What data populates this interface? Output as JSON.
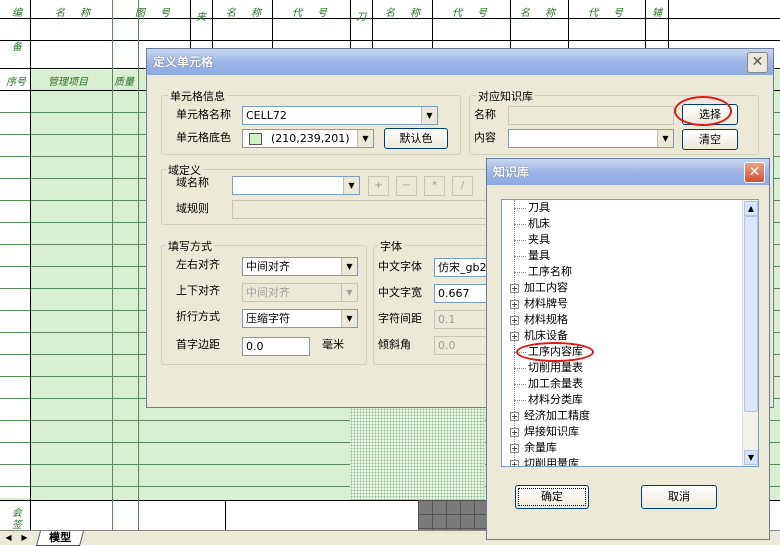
{
  "sheet": {
    "header_texts": [
      "编",
      "名 称",
      "图 号",
      "夹",
      "名 称",
      "代 号",
      "刀",
      "名 称",
      "代 号",
      "名 称",
      "代 号",
      "辅",
      "备",
      "序号",
      "管理项目",
      "质量",
      "会",
      "签"
    ],
    "tab_nav": [
      "◀",
      "▶"
    ],
    "tab_label": "模型"
  },
  "cell_dialog": {
    "title": "定义单元格",
    "close": "✕",
    "cell_info": {
      "group": "单元格信息",
      "name_label": "单元格名称",
      "name_value": "CELL72",
      "color_label": "单元格底色",
      "color_value": "(210,239,201)",
      "color_hex": "#d2efc9",
      "default_color_button": "默认色"
    },
    "knowledge": {
      "group": "对应知识库",
      "name_label": "名称",
      "content_label": "内容",
      "select_button": "选择",
      "clear_button": "清空"
    },
    "domain": {
      "group": "域定义",
      "name_label": "域名称",
      "rule_label": "域规则",
      "ops": [
        "+",
        "−",
        "*",
        "/"
      ]
    },
    "fill": {
      "group": "填写方式",
      "h_align_label": "左右对齐",
      "h_align_value": "中间对齐",
      "v_align_label": "上下对齐",
      "v_align_value": "中间对齐",
      "wrap_label": "折行方式",
      "wrap_value": "压缩字符",
      "indent_label": "首字边距",
      "indent_value": "0.0",
      "indent_unit": "毫米"
    },
    "font": {
      "group": "字体",
      "cn_font_label": "中文字体",
      "cn_font_value": "仿宋_gb2",
      "cn_width_label": "中文字宽",
      "cn_width_value": "0.667",
      "spacing_label": "字符间距",
      "spacing_value": "0.1",
      "slant_label": "倾斜角",
      "slant_value": "0.0"
    }
  },
  "kb_dialog": {
    "title": "知识库",
    "close": "✕",
    "items": [
      {
        "label": "刀具",
        "expandable": false
      },
      {
        "label": "机床",
        "expandable": false
      },
      {
        "label": "夹具",
        "expandable": false
      },
      {
        "label": "量具",
        "expandable": false
      },
      {
        "label": "工序名称",
        "expandable": false
      },
      {
        "label": "加工内容",
        "expandable": true
      },
      {
        "label": "材料牌号",
        "expandable": true
      },
      {
        "label": "材料规格",
        "expandable": true
      },
      {
        "label": "机床设备",
        "expandable": true
      },
      {
        "label": "工序内容库",
        "expandable": false
      },
      {
        "label": "切削用量表",
        "expandable": false
      },
      {
        "label": "加工余量表",
        "expandable": false
      },
      {
        "label": "材料分类库",
        "expandable": false
      },
      {
        "label": "经济加工精度",
        "expandable": true
      },
      {
        "label": "焊接知识库",
        "expandable": true
      },
      {
        "label": "余量库",
        "expandable": true
      },
      {
        "label": "切削用量库",
        "expandable": true
      }
    ],
    "expand_glyph": "+",
    "ok_button": "确定",
    "cancel_button": "取消",
    "scroll_up": "▲",
    "scroll_down": "▼"
  },
  "colors": {
    "sheet_bg": "#d8f0d0",
    "highlight": "#e01818"
  }
}
